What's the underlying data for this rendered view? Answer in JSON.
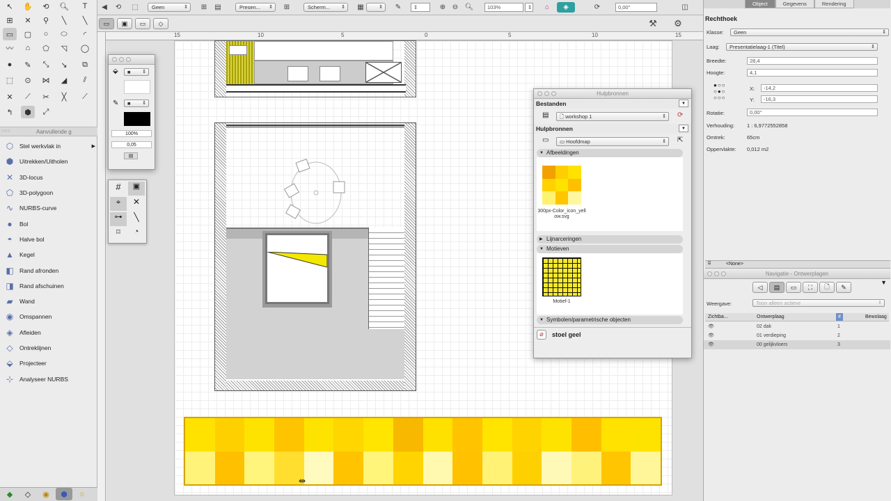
{
  "toolbar": {
    "class_dd": "Geen",
    "layer_dd": "Presen...",
    "view_dd": "Scherm...",
    "zoom_value": "103%",
    "angle_value": "0,00°"
  },
  "tool_set_header": "Aanvullende g",
  "tools": [
    {
      "label": "Stel werkvlak in",
      "icon": "⬡"
    },
    {
      "label": "Uitrekken/Uitholen",
      "icon": "⬢"
    },
    {
      "label": "3D-locus",
      "icon": "✕"
    },
    {
      "label": "3D-polygoon",
      "icon": "⬠"
    },
    {
      "label": "NURBS-curve",
      "icon": "∿"
    },
    {
      "label": "Bol",
      "icon": "●"
    },
    {
      "label": "Halve bol",
      "icon": "◓"
    },
    {
      "label": "Kegel",
      "icon": "▲"
    },
    {
      "label": "Rand afronden",
      "icon": "◧"
    },
    {
      "label": "Rand afschuinen",
      "icon": "◨"
    },
    {
      "label": "Wand",
      "icon": "▰"
    },
    {
      "label": "Omspannen",
      "icon": "◉"
    },
    {
      "label": "Afleiden",
      "icon": "◈"
    },
    {
      "label": "Ontreklijnen",
      "icon": "◇"
    },
    {
      "label": "Projecteer",
      "icon": "⬙"
    },
    {
      "label": "Analyseer NURBS",
      "icon": "⊹"
    }
  ],
  "ruler_labels": [
    "15",
    "10",
    "5",
    "0",
    "5",
    "10",
    "15"
  ],
  "attr_palette": {
    "zoom": "100%",
    "thickness": "0,05"
  },
  "resource_browser": {
    "title": "Hulpbronnen",
    "files_label": "Bestanden",
    "file_select": "workshop 1",
    "resources_label": "Hulpbronnen",
    "folder_select": "Hoofdmap",
    "images_header": "Afbeeldingen",
    "image_name": "300px-Color_icon_yellow.svg",
    "line_types_header": "Lijnarceringen",
    "patterns_header": "Motieven",
    "pattern_name": "Motief-1",
    "symbols_header": "Symbolen/parametrische objecten",
    "selected": "stoel geel"
  },
  "info_palette": {
    "tabs": [
      "Object",
      "Gegevens",
      "Rendering"
    ],
    "object_type": "Rechthoek",
    "klasse_label": "Klasse:",
    "klasse_value": "Geen",
    "laag_label": "Laag:",
    "laag_value": "Presentatielaag-1 (Titel)",
    "breedte_label": "Breedte:",
    "breedte_value": "28,4",
    "hoogte_label": "Hoogte:",
    "hoogte_value": "4,1",
    "x_label": "X:",
    "x_value": "-14,2",
    "y_label": "Y:",
    "y_value": "-16,3",
    "rotatie_label": "Rotatie:",
    "rotatie_value": "0,00°",
    "verhouding_label": "Verhouding:",
    "verhouding_value": "1 : 6,9772552858",
    "omtrek_label": "Omtrek:",
    "omtrek_value": "65cm",
    "oppervlakte_label": "Oppervlakte:",
    "oppervlakte_value": "0,012 m2",
    "record": "<None>"
  },
  "navigation": {
    "title": "Navigatie - Ontwerplagen",
    "weergave_label": "Weergave:",
    "weergave_value": "Toon alleen actieve",
    "columns": [
      "Zichtba...",
      "Ontwerplaag",
      "#",
      "Bewolaag"
    ],
    "rows": [
      {
        "name": "02 dak",
        "num": "1"
      },
      {
        "name": "01 verdieping",
        "num": "2"
      },
      {
        "name": "00 gelijkvloers",
        "num": "3"
      }
    ]
  },
  "colors": {
    "accent": "#f7e400",
    "orange": "#f5a300",
    "selection": "#888888"
  }
}
